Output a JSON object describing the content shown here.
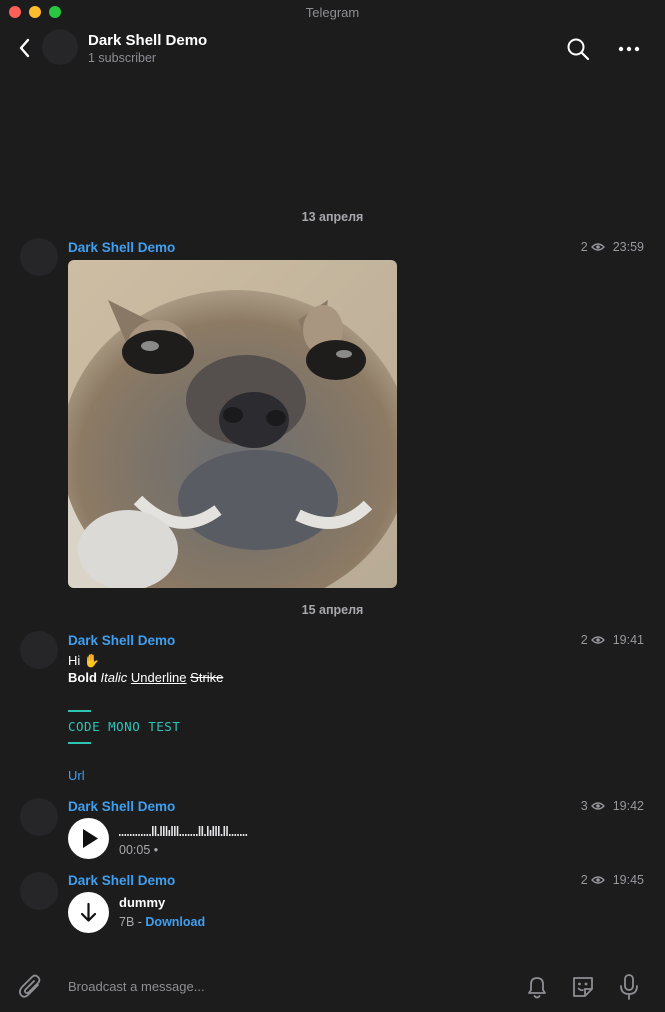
{
  "window": {
    "title": "Telegram"
  },
  "header": {
    "channel_name": "Dark Shell Demo",
    "subscribers": "1 subscriber"
  },
  "dates": [
    "13 апреля",
    "15 апреля"
  ],
  "messages": [
    {
      "sender": "Dark Shell Demo",
      "views": "2",
      "time": "23:59",
      "type": "photo"
    },
    {
      "sender": "Dark Shell Demo",
      "views": "2",
      "time": "19:41",
      "type": "text",
      "line1": "Hi ✋",
      "bold": "Bold",
      "italic": "Italic",
      "underline": "Underline",
      "strike": "Strike",
      "code": "CODE MONO TEST",
      "url": "Url"
    },
    {
      "sender": "Dark Shell Demo",
      "views": "3",
      "time": "19:42",
      "type": "voice",
      "duration": "00:05",
      "unread_dot": "•"
    },
    {
      "sender": "Dark Shell Demo",
      "views": "2",
      "time": "19:45",
      "type": "file",
      "file_name": "dummy",
      "file_size": "7B",
      "separator": " - ",
      "download_label": "Download"
    }
  ],
  "composer": {
    "placeholder": "Broadcast a message..."
  },
  "colors": {
    "background": "#1c1c1d",
    "accent": "#3f9ff0",
    "code": "#2ec4b6"
  },
  "icons": [
    "back-arrow-icon",
    "search-icon",
    "more-icon",
    "eye-icon",
    "play-icon",
    "download-icon",
    "paperclip-icon",
    "bell-icon",
    "sticker-icon",
    "microphone-icon"
  ]
}
